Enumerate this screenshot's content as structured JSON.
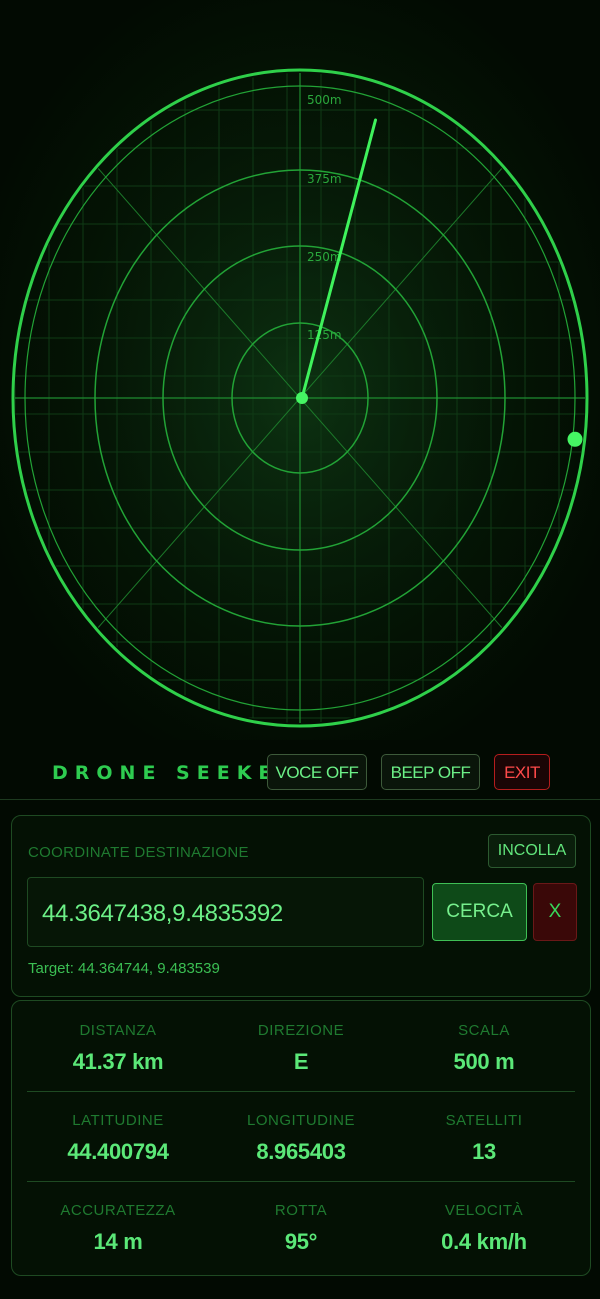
{
  "radar": {
    "scale_labels": [
      "500m",
      "375m",
      "250m",
      "125m"
    ],
    "sweep_bearing_deg": 27,
    "marker_bearing_deg": 95
  },
  "header": {
    "title": "DRONE SEEKER",
    "voice_label": "VOCE OFF",
    "beep_label": "BEEP OFF",
    "exit_label": "EXIT"
  },
  "coordinates": {
    "label": "COORDINATE DESTINAZIONE",
    "paste_label": "INCOLLA",
    "input_value": "44.3647438,9.4835392",
    "search_label": "CERCA",
    "clear_label": "X",
    "target_text": "Target: 44.364744, 9.483539"
  },
  "stats": [
    [
      {
        "label": "DISTANZA",
        "value": "41.37 km"
      },
      {
        "label": "DIREZIONE",
        "value": "E"
      },
      {
        "label": "SCALA",
        "value": "500 m"
      }
    ],
    [
      {
        "label": "LATITUDINE",
        "value": "44.400794"
      },
      {
        "label": "LONGITUDINE",
        "value": "8.965403"
      },
      {
        "label": "SATELLITI",
        "value": "13"
      }
    ],
    [
      {
        "label": "ACCURATEZZA",
        "value": "14 m"
      },
      {
        "label": "ROTTA",
        "value": "95°"
      },
      {
        "label": "VELOCITÀ",
        "value": "0.4 km/h"
      }
    ]
  ],
  "colors": {
    "accent": "#3fdc5a",
    "background": "#020a02",
    "danger": "#ff4a4a"
  }
}
